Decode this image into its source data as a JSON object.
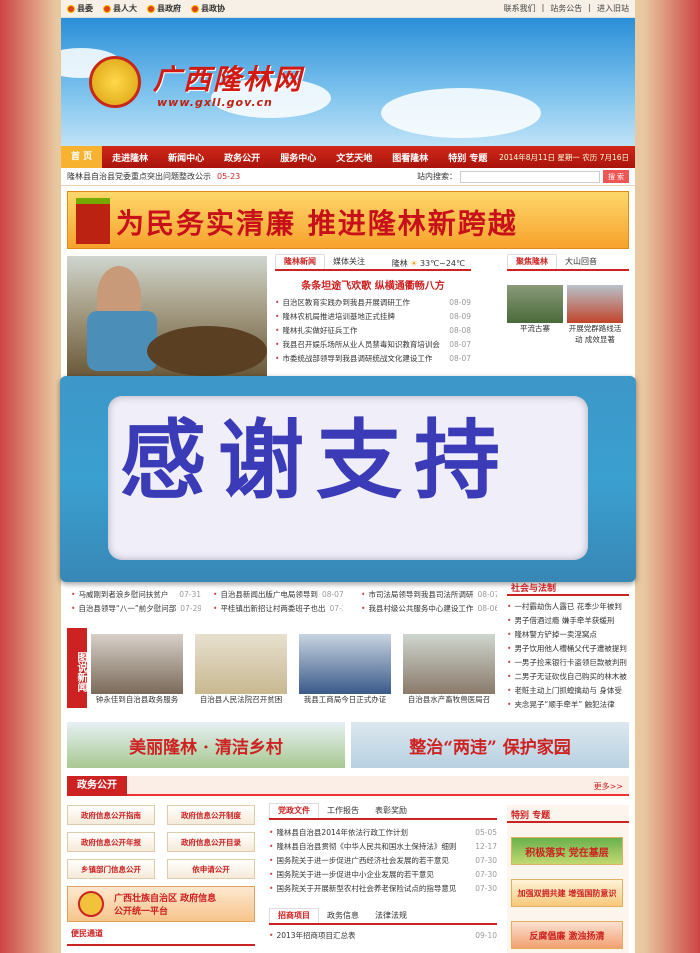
{
  "topbar": {
    "left_links": [
      "县委",
      "县人大",
      "县政府",
      "县政协"
    ],
    "right_links": [
      "联系我们",
      "站务公告",
      "进入旧站"
    ]
  },
  "banner": {
    "title": "广西隆林网",
    "url": "www.gxll.gov.cn"
  },
  "nav": {
    "items": [
      "首 页",
      "走进隆林",
      "新闻中心",
      "政务公开",
      "服务中心",
      "文艺天地",
      "图看隆林",
      "特别 专题"
    ],
    "date": "2014年8月11日 星期一 农历 7月16日"
  },
  "ticker": {
    "text": "隆林县自治县党委重点突出问题整改公示",
    "date": "05-23",
    "search_label": "站内搜索：",
    "search_btn": "搜 索"
  },
  "slogan": "为民务实清廉  推进隆林新跨越",
  "news": {
    "tabs": [
      "隆林新闻",
      "媒体关注"
    ],
    "weather_city": "隆林",
    "weather_temp": "33℃~24℃",
    "headline": "条条坦途飞欢歌  纵横通衢畅八方",
    "items": [
      {
        "t": "自治区教育实践办到我县开展调研工作",
        "d": "08-09"
      },
      {
        "t": "隆林农机局推进培训基地正式挂牌",
        "d": "08-09"
      },
      {
        "t": "隆林扎实做好征兵工作",
        "d": "08-08"
      },
      {
        "t": "我县召开娱乐场所从业人员禁毒知识教育培训会",
        "d": "08-07"
      },
      {
        "t": "市委统战部领导到我县调研统战文化建设工作",
        "d": "08-07"
      }
    ]
  },
  "focus": {
    "tabs": [
      "聚焦隆林",
      "大山回音"
    ],
    "captions": [
      "平流古寨",
      "开展党群路线活动 成效显著"
    ]
  },
  "overlay_text": "感谢支持",
  "lower_lists": {
    "col1": [
      {
        "t": "马威刚到者浪乡慰问扶贫户",
        "d": "07-31"
      },
      {
        "t": "自治县领导“八一”前夕慰问部",
        "d": "07-29"
      }
    ],
    "col2": [
      {
        "t": "自治县新闻出版广电局领导到",
        "d": "08-07"
      },
      {
        "t": "平桂镇出新招让村两委班子也出",
        "d": "07-30"
      }
    ],
    "col3": [
      {
        "t": "市司法局领导到我县司法所调研",
        "d": "08-07"
      },
      {
        "t": "我县村级公共服务中心建设工作",
        "d": "08-06"
      }
    ]
  },
  "law": {
    "title": "社会与法制",
    "items": [
      "一村霸劫伤人露已 花季少年被判",
      "男子借酒过瘾 嫌手牵羊获缓刑",
      "隆林警方铲掉一卖淫窝点",
      "男子饮用他人槽桶父代子遭被提判",
      "一男子捡来银行卡盗领巨款被判刑",
      "二男子无证砍伐自己购买的林木被",
      "老赃主动上门抓蝗擒劫与 身体受",
      "夹念晃子“顺手牵羊” 触犯法律"
    ]
  },
  "photo_news": {
    "label": "图说新闻",
    "captions": [
      "钟永佳到自治县政务服务",
      "自治县人民法院召开贫困",
      "我县工商局今日正式办证",
      "自治县水产畜牧兽医局召"
    ]
  },
  "banners": {
    "left": "美丽隆林 · 清洁乡村",
    "right": "整治“两违” 保护家园"
  },
  "gov": {
    "title": "政务公开",
    "more": "更多>>",
    "buttons": [
      "政府信息公开指南",
      "政府信息公开制度",
      "政府信息公开年报",
      "政府信息公开目录",
      "乡镇部门信息公开",
      "依申请公开"
    ],
    "platform": "广西壮族自治区 政府信息公开统一平台",
    "sub": "便民通道",
    "tabs": [
      "党政文件",
      "工作报告",
      "表彰奖励"
    ],
    "items": [
      {
        "t": "隆林县自治县2014年依法行政工作计划",
        "d": "05-05"
      },
      {
        "t": "隆林县自治县贯彻《中华人民共和国水土保持法》细则",
        "d": "12-17"
      },
      {
        "t": "国务院关于进一步促进广西经济社会发展的若干意见",
        "d": "07-30"
      },
      {
        "t": "国务院关于进一步促进中小企业发展的若干意见",
        "d": "07-30"
      },
      {
        "t": "国务院关于开展新型农村社会养老保险试点的指导意见",
        "d": "07-30"
      }
    ],
    "tabs2": [
      "招商项目",
      "政务信息",
      "法律法规"
    ],
    "items2": [
      {
        "t": "2013年招商项目汇总表",
        "d": "09-10"
      }
    ]
  },
  "special": {
    "title": "特别 专题",
    "blocks": [
      "积极落实  党在基层",
      "加强双拥共建 增强国防意识",
      "反腐倡廉 激浊扬清"
    ]
  }
}
